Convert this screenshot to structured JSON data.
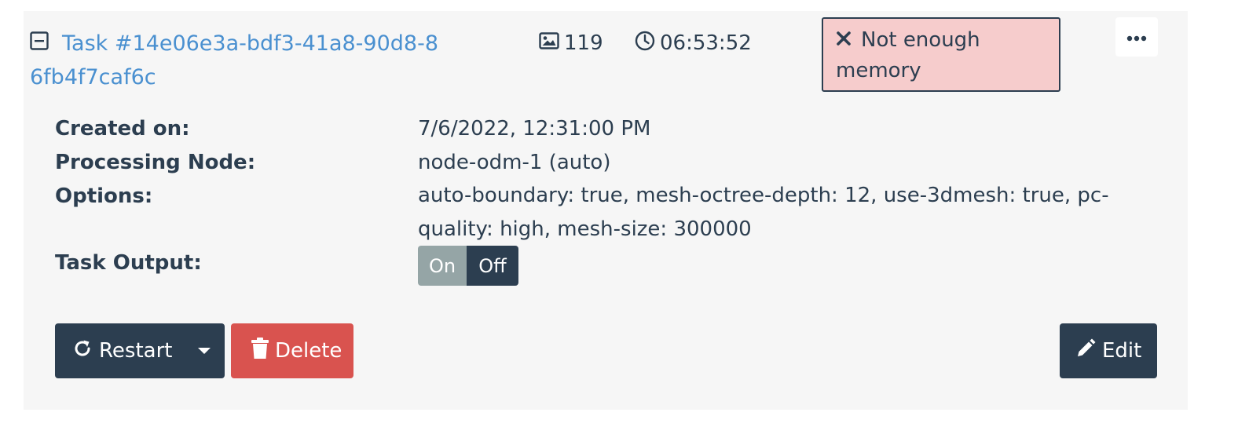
{
  "task": {
    "title": "Task #14e06e3a-bdf3-41a8-90d8-86fb4f7caf6c",
    "image_count": "119",
    "elapsed": "06:53:52",
    "status_text": "Not enough memory"
  },
  "details": {
    "created_label": "Created on:",
    "created_value": "7/6/2022, 12:31:00 PM",
    "node_label": "Processing Node:",
    "node_value": "node-odm-1 (auto)",
    "options_label": "Options:",
    "options_value": "auto-boundary: true, mesh-octree-depth: 12, use-3dmesh: true, pc-quality: high, mesh-size: 300000",
    "output_label": "Task Output:",
    "toggle_on": "On",
    "toggle_off": "Off"
  },
  "actions": {
    "restart_label": "Restart",
    "delete_label": "Delete",
    "edit_label": "Edit"
  },
  "colors": {
    "link": "#4a90d0",
    "dark": "#2c3e50",
    "danger": "#d9534f",
    "error_bg": "#f6cccc",
    "panel_bg": "#f6f6f6"
  },
  "icons": {
    "collapse": "minus-square-icon",
    "images": "image-icon",
    "time": "clock-icon",
    "status": "times-icon",
    "more": "ellipsis-icon",
    "restart": "refresh-icon",
    "dropdown": "caret-down-icon",
    "delete": "trash-icon",
    "edit": "pencil-icon"
  }
}
